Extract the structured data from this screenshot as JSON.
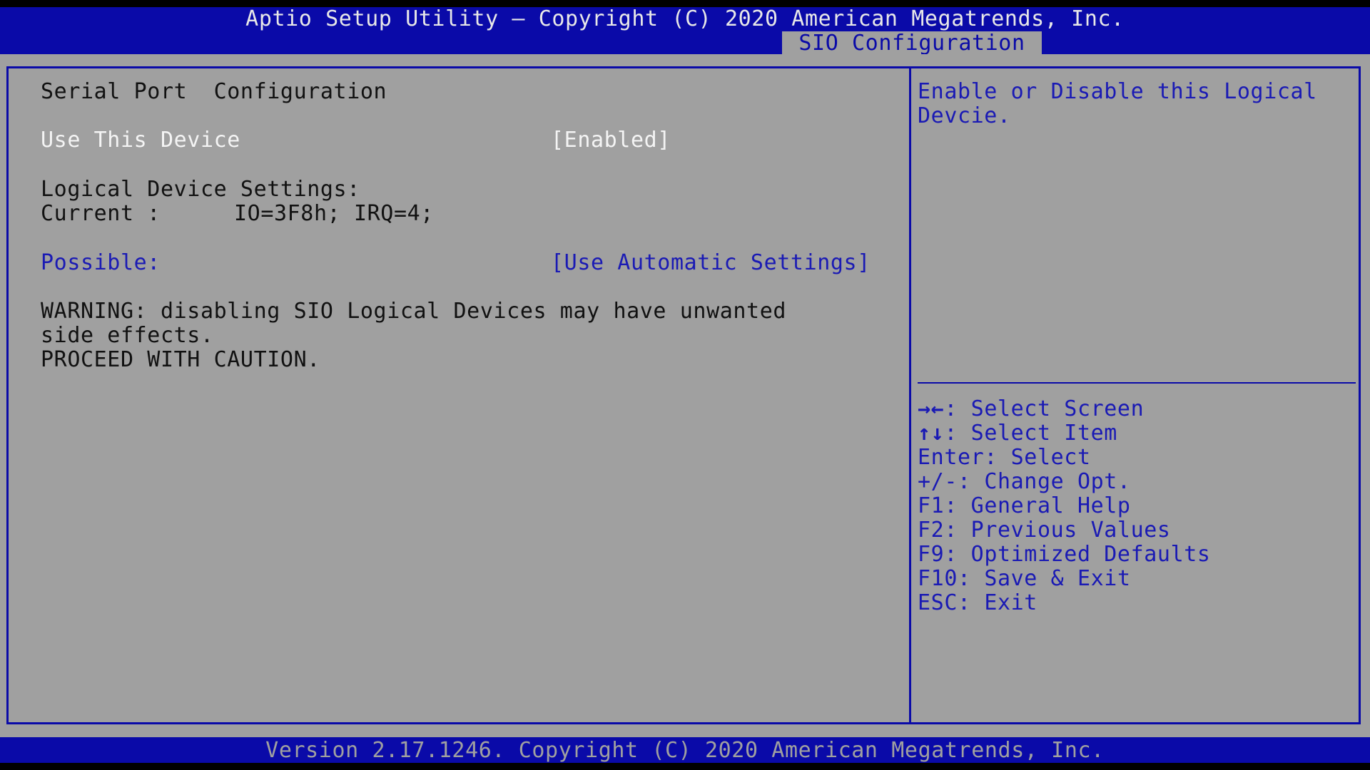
{
  "header": {
    "title": "Aptio Setup Utility – Copyright (C) 2020 American Megatrends, Inc.",
    "active_tab": "SIO Configuration"
  },
  "main": {
    "section_title": "Serial Port  Configuration",
    "use_device": {
      "label": "Use This Device",
      "value": "[Enabled]"
    },
    "logical_settings_label": "Logical Device Settings:",
    "current_label": "Current :",
    "current_value": "IO=3F8h; IRQ=4;",
    "possible": {
      "label": "Possible:",
      "value": "[Use Automatic Settings]"
    },
    "warning_line1": "WARNING: disabling SIO Logical Devices may have unwanted",
    "warning_line2": "side effects.",
    "warning_line3": "PROCEED WITH CAUTION."
  },
  "help": {
    "line1": "Enable or Disable this Logical",
    "line2": "Devcie."
  },
  "keys": [
    {
      "key": "→←",
      "action": ": Select Screen"
    },
    {
      "key": "↑↓",
      "action": ": Select Item"
    },
    {
      "key": "Enter",
      "action": ": Select"
    },
    {
      "key": "+/-",
      "action": ": Change Opt."
    },
    {
      "key": "F1",
      "action": ": General Help"
    },
    {
      "key": "F2",
      "action": ": Previous Values"
    },
    {
      "key": "F9",
      "action": ": Optimized Defaults"
    },
    {
      "key": "F10",
      "action": ": Save & Exit"
    },
    {
      "key": "ESC",
      "action": ": Exit"
    }
  ],
  "footer": {
    "version": "Version 2.17.1246. Copyright (C) 2020 American Megatrends, Inc."
  },
  "colors": {
    "bios_blue": "#0a0aa8",
    "panel_gray": "#a0a0a0",
    "highlight_white": "#f4f4f4"
  }
}
